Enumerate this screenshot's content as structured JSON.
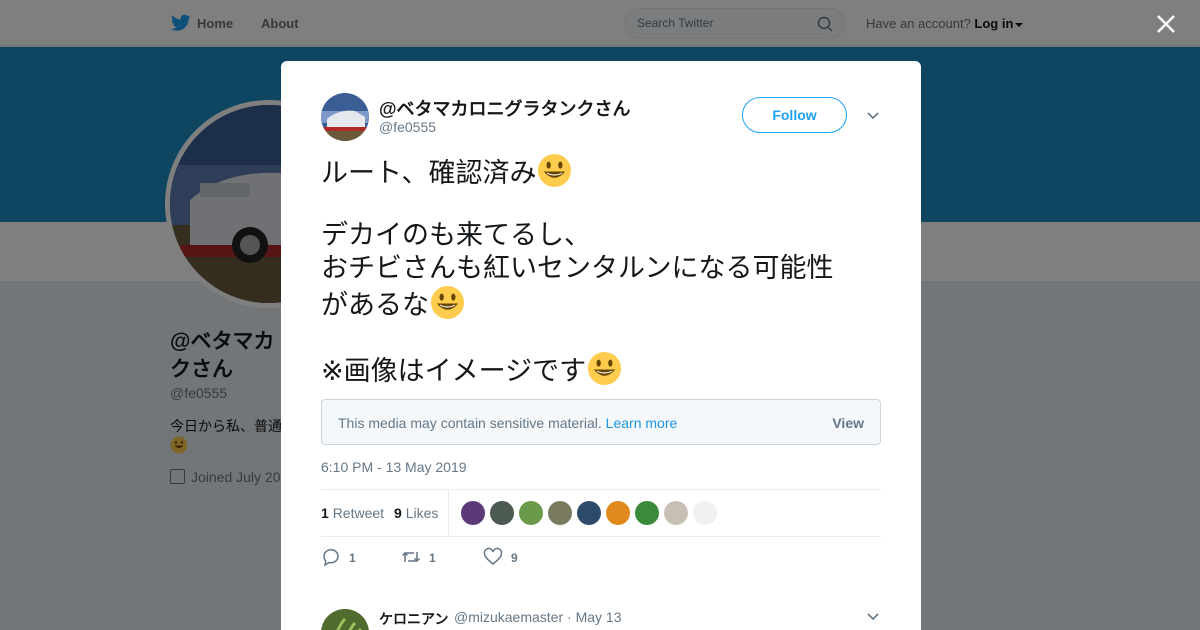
{
  "nav": {
    "home_label": "Home",
    "about_label": "About",
    "search_placeholder": "Search Twitter",
    "account_prompt": "Have an account?",
    "login_label": "Log in"
  },
  "profile": {
    "name_line1": "@ベタマカ",
    "name_line2": "クさん",
    "handle": "@fe0555",
    "bio": "今日から私、普通",
    "joined": "Joined July 20"
  },
  "tweet": {
    "author_name": "@ベタマカロニグラタンクさん",
    "author_handle": "@fe0555",
    "follow_label": "Follow",
    "lines": [
      "ルート、確認済み",
      "デカイのも来てるし、",
      "おチビさんも紅いセンタルンになる可能性",
      "があるな",
      "※画像はイメージです"
    ],
    "sensitive_message": "This media may contain sensitive material.",
    "learn_more_label": "Learn more",
    "view_label": "View",
    "timestamp": "6:10 PM - 13 May 2019",
    "retweet_count": "1",
    "retweet_label": "Retweet",
    "like_count": "9",
    "like_label": "Likes",
    "reply_action_count": "1",
    "retweet_action_count": "1",
    "like_action_count": "9"
  },
  "reply": {
    "name": "ケロニアン",
    "handle_date": "@mizukaemaster · May 13"
  },
  "colors": {
    "accent": "#1da1f2",
    "banner": "#1d8dc2",
    "overlay": "rgba(0,0,0,0.5)"
  }
}
